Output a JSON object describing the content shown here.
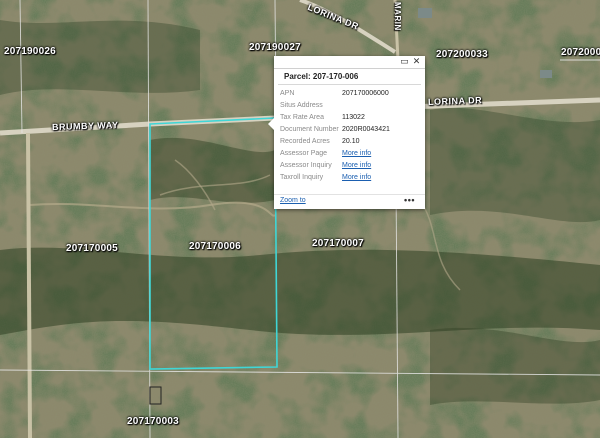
{
  "map": {
    "parcel_labels": [
      "207190026",
      "207190027",
      "207200033",
      "2072000",
      "207170005",
      "207170006",
      "207170007",
      "207170003"
    ],
    "road_labels": [
      "LORINA DR",
      "BRUMBY WAY",
      "LORINA DR",
      "MARIN"
    ],
    "colors": {
      "selected_outline": "#3fd6d6",
      "parcel_line": "#e8e8e8",
      "road": "#d7d2c0"
    }
  },
  "popup": {
    "title": "Parcel: 207-170-006",
    "icons": [
      "maximize-icon",
      "close-icon"
    ],
    "maximize_glyph": "▭",
    "close_glyph": "✕",
    "fields": [
      {
        "label": "APN",
        "value": "207170006000"
      },
      {
        "label": "Situs Address",
        "value": ""
      },
      {
        "label": "Tax Rate Area",
        "value": "113022"
      },
      {
        "label": "Document Number",
        "value": "2020R0043421"
      },
      {
        "label": "Recorded Acres",
        "value": "20.10"
      },
      {
        "label": "Assessor Page",
        "link": "More info"
      },
      {
        "label": "Assessor Inquiry",
        "link": "More info"
      },
      {
        "label": "Taxroll Inquiry",
        "link": "More info"
      }
    ],
    "zoom_label": "Zoom to",
    "more_label": "•••"
  }
}
